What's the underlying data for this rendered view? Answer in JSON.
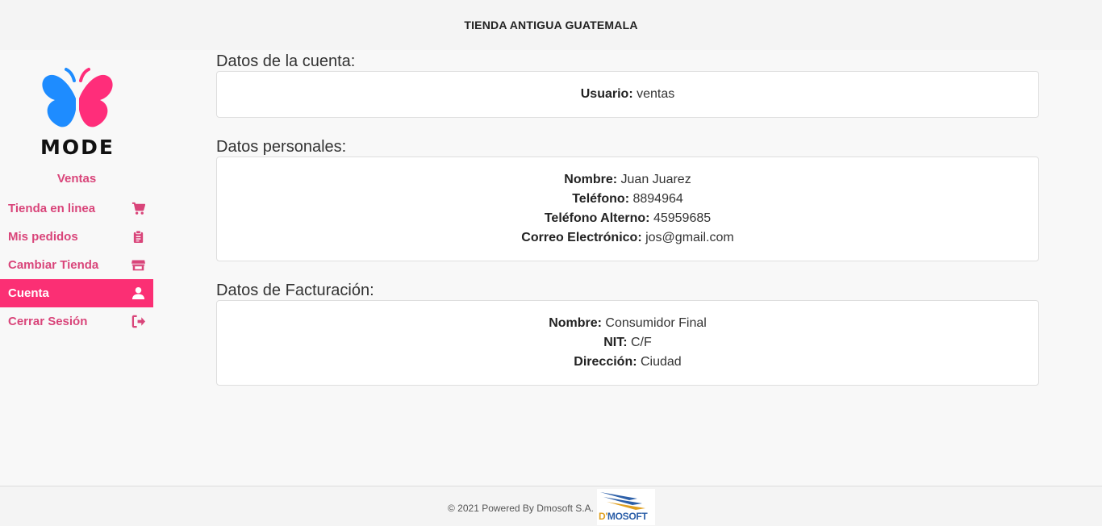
{
  "header": {
    "title": "TIENDA ANTIGUA GUATEMALA"
  },
  "sidebar": {
    "logo_text": "MODE",
    "role": "Ventas",
    "items": [
      {
        "label": "Tienda en linea",
        "icon": "shopping-cart-icon",
        "active": false
      },
      {
        "label": "Mis pedidos",
        "icon": "clipboard-icon",
        "active": false
      },
      {
        "label": "Cambiar Tienda",
        "icon": "store-icon",
        "active": false
      },
      {
        "label": "Cuenta",
        "icon": "user-icon",
        "active": true
      },
      {
        "label": "Cerrar Sesión",
        "icon": "sign-out-icon",
        "active": false
      }
    ]
  },
  "account": {
    "title": "Datos de la cuenta:",
    "user_label": "Usuario:",
    "user_value": "ventas"
  },
  "personal": {
    "title": "Datos personales:",
    "name_label": "Nombre:",
    "name_value": "Juan Juarez",
    "phone_label": "Teléfono:",
    "phone_value": "8894964",
    "alt_phone_label": "Teléfono Alterno:",
    "alt_phone_value": "45959685",
    "email_label": "Correo Electrónico:",
    "email_value": "jos@gmail.com"
  },
  "billing": {
    "title": "Datos de Facturación:",
    "name_label": "Nombre:",
    "name_value": "Consumidor Final",
    "nit_label": "NIT:",
    "nit_value": "C/F",
    "address_label": "Dirección:",
    "address_value": "Ciudad"
  },
  "footer": {
    "text": "© 2021 Powered By Dmosoft S.A.",
    "logo_text_d": "D'",
    "logo_text_rest": "MOSOFT"
  },
  "colors": {
    "accent": "#fb2f74",
    "nav_text": "#d9457a",
    "logo_blue": "#1e8cff",
    "logo_pink": "#ff2d7a"
  }
}
